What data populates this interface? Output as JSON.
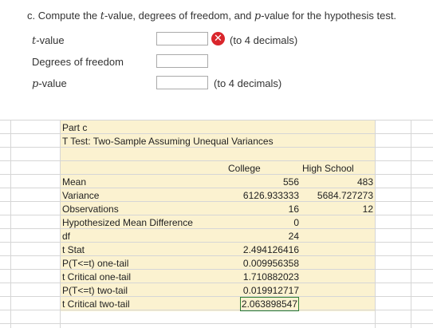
{
  "question": {
    "prefix": "c. Compute the ",
    "t_symbol": "t",
    "middle": "-value, degrees of freedom, and ",
    "p_symbol": "p",
    "suffix": "-value for the hypothesis test."
  },
  "fields": {
    "t_value": {
      "label_symbol": "t",
      "label_rest": "-value",
      "value": "",
      "hint": "(to 4 decimals)"
    },
    "dof": {
      "label": "Degrees of freedom",
      "value": ""
    },
    "p_value": {
      "label_symbol": "p",
      "label_rest": "-value",
      "value": "",
      "hint": "(to 4 decimals)"
    }
  },
  "spreadsheet": {
    "section": "Part c",
    "title": "T Test: Two-Sample Assuming Unequal Variances",
    "columns": [
      "College",
      "High School"
    ],
    "rows": [
      {
        "label": "Mean",
        "c1": "556",
        "c2": "483"
      },
      {
        "label": "Variance",
        "c1": "6126.933333",
        "c2": "5684.727273"
      },
      {
        "label": "Observations",
        "c1": "16",
        "c2": "12"
      },
      {
        "label": "Hypothesized Mean Difference",
        "c1": "0",
        "c2": ""
      },
      {
        "label": "df",
        "c1": "24",
        "c2": ""
      },
      {
        "label": "t Stat",
        "c1": "2.494126416",
        "c2": ""
      },
      {
        "label": "P(T<=t) one-tail",
        "c1": "0.009956358",
        "c2": ""
      },
      {
        "label": "t Critical one-tail",
        "c1": "1.710882023",
        "c2": ""
      },
      {
        "label": "P(T<=t) two-tail",
        "c1": "0.019912717",
        "c2": ""
      },
      {
        "label": "t Critical two-tail",
        "c1": "2.063898547",
        "c2": ""
      }
    ]
  }
}
